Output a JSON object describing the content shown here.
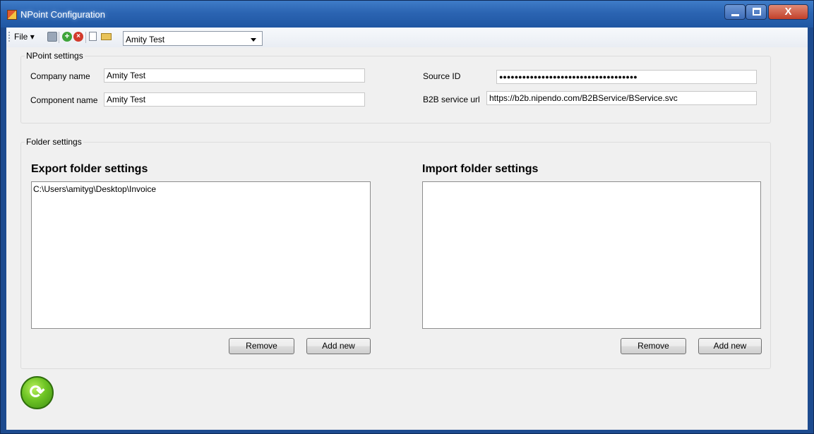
{
  "window": {
    "title": "NPoint Configuration",
    "close_glyph": "X"
  },
  "toolbar": {
    "file_label": "File",
    "file_arrow": "▾",
    "add_glyph": "+",
    "delete_glyph": "×",
    "profile_combo_value": "Amity Test"
  },
  "npoint_settings": {
    "group_label": "NPoint settings",
    "company_name_label": "Company name",
    "company_name_value": "Amity Test",
    "component_name_label": "Component name",
    "component_name_value": "Amity Test",
    "source_id_label": "Source ID",
    "source_id_masked": "●●●●●●●●●●●●●●●●●●●●●●●●●●●●●●●●●●●●",
    "b2b_url_label": "B2B service url",
    "b2b_url_value": "https://b2b.nipendo.com/B2BService/BService.svc"
  },
  "folder_settings": {
    "group_label": "Folder settings",
    "export": {
      "title": "Export folder settings",
      "items": [
        "C:\\Users\\amityg\\Desktop\\Invoice"
      ],
      "remove_label": "Remove",
      "add_label": "Add new"
    },
    "import": {
      "title": "Import folder settings",
      "items": [],
      "remove_label": "Remove",
      "add_label": "Add new"
    }
  },
  "refresh_glyph": "⟳",
  "colors": {
    "titlebar": "#2b64b2",
    "client_bg": "#f0f0f0",
    "refresh_green": "#6dc324"
  }
}
